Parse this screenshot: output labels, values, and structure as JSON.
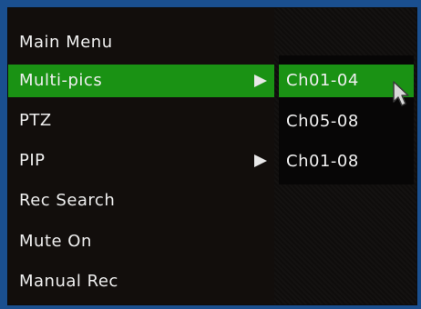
{
  "main_menu": {
    "title": "Main Menu",
    "items": [
      {
        "label": "Multi-pics",
        "has_submenu": true,
        "selected": true
      },
      {
        "label": "PTZ",
        "has_submenu": false,
        "selected": false
      },
      {
        "label": "PIP",
        "has_submenu": true,
        "selected": false
      },
      {
        "label": "Rec Search",
        "has_submenu": false,
        "selected": false
      },
      {
        "label": "Mute On",
        "has_submenu": false,
        "selected": false
      },
      {
        "label": "Manual Rec",
        "has_submenu": false,
        "selected": false
      }
    ]
  },
  "submenu": {
    "items": [
      {
        "label": "Ch01-04",
        "selected": true
      },
      {
        "label": "Ch05-08",
        "selected": false
      },
      {
        "label": "Ch01-08",
        "selected": false
      }
    ]
  },
  "colors": {
    "highlight": "#1a9214",
    "menu_background": "#120e0c",
    "text": "#efefef",
    "border": "#1a4f8f"
  },
  "icons": {
    "submenu_arrow": "triangle-right-icon",
    "pointer": "mouse-pointer-icon"
  }
}
